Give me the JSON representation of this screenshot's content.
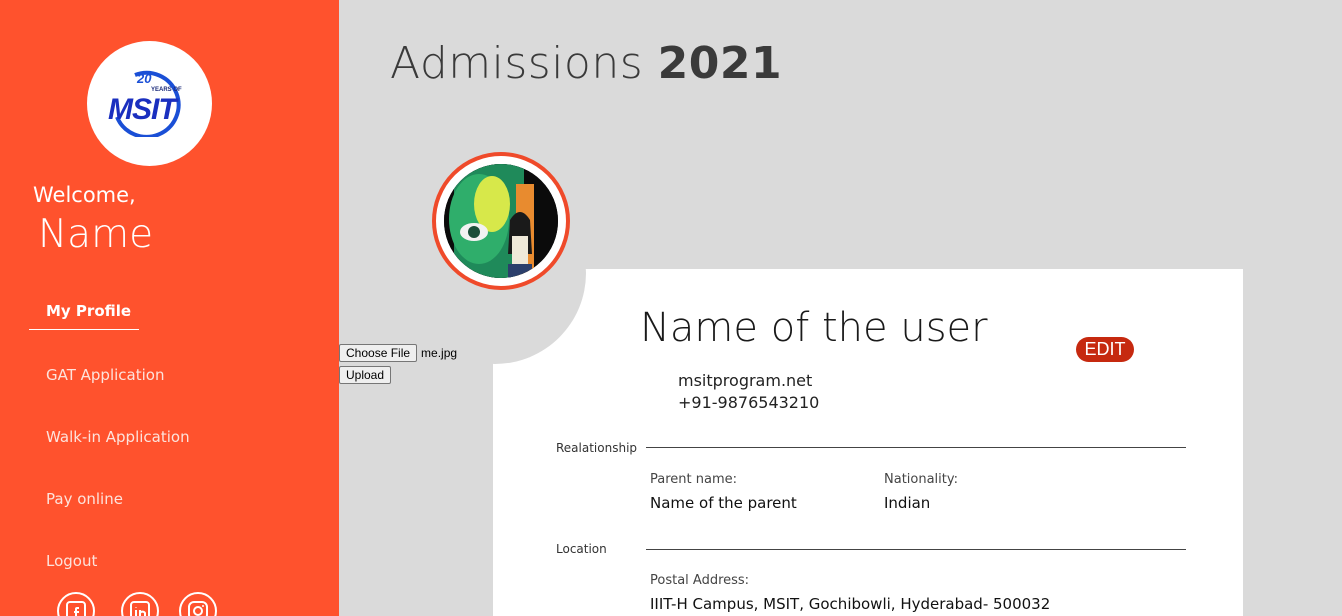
{
  "sidebar": {
    "logo_text": "MSIT",
    "logo_badge": "20",
    "logo_badge_sub": "YEARS OF",
    "welcome": "Welcome,",
    "user_name": "Name",
    "nav": [
      {
        "label": "My Profile",
        "active": true
      },
      {
        "label": "GAT Application",
        "active": false
      },
      {
        "label": "Walk-in Application",
        "active": false
      },
      {
        "label": "Pay online",
        "active": false
      },
      {
        "label": "Logout",
        "active": false
      }
    ],
    "social_icons": [
      "facebook-icon",
      "linkedin-icon",
      "instagram-icon"
    ]
  },
  "header": {
    "title_light": "Admissions ",
    "title_bold": "2021"
  },
  "upload": {
    "choose_label": "Choose File",
    "file_name": "me.jpg",
    "upload_label": "Upload"
  },
  "profile": {
    "name": "Name of the user",
    "edit_label": "EDIT",
    "website": "msitprogram.net",
    "phone": "+91-9876543210"
  },
  "sections": {
    "relationship": {
      "label": "Realationship",
      "parent_label": "Parent name:",
      "parent_value": "Name of the parent",
      "nationality_label": "Nationality:",
      "nationality_value": "Indian"
    },
    "location": {
      "label": "Location",
      "postal_label": "Postal Address:",
      "postal_value": "IIIT-H Campus, MSIT, Gochibowli, Hyderabad- 500032"
    }
  },
  "colors": {
    "sidebar": "#ff522d",
    "edit_button": "#c6290f",
    "background": "#dadada"
  }
}
